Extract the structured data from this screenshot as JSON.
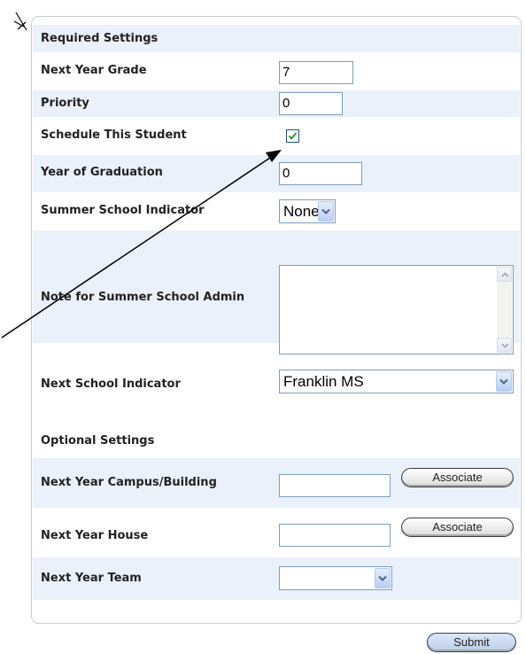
{
  "sections": {
    "required": "Required Settings",
    "optional": "Optional Settings"
  },
  "fields": {
    "next_year_grade": {
      "label": "Next Year Grade",
      "value": "7"
    },
    "priority": {
      "label": "Priority",
      "value": "0"
    },
    "schedule_student": {
      "label": "Schedule This Student",
      "checked": true
    },
    "year_of_graduation": {
      "label": "Year of Graduation",
      "value": "0"
    },
    "summer_school_indicator": {
      "label": "Summer School Indicator",
      "selected": "None"
    },
    "note_summer_admin": {
      "label": "Note for Summer School Admin",
      "value": ""
    },
    "next_school_indicator": {
      "label": "Next School Indicator",
      "selected": "Franklin MS"
    },
    "next_year_campus": {
      "label": "Next Year Campus/Building",
      "value": "",
      "button": "Associate"
    },
    "next_year_house": {
      "label": "Next Year House",
      "value": "",
      "button": "Associate"
    },
    "next_year_team": {
      "label": "Next Year Team",
      "selected": ""
    }
  },
  "submit_label": "Submit",
  "colors": {
    "row_alt": "#eaf1fb",
    "border": "#c9ccd2",
    "input_border": "#7f9db9",
    "check": "#2a9a2a"
  },
  "icons": [
    "checkmark-icon",
    "chevron-down-icon",
    "chevron-up-icon",
    "annotation-arrow-icon",
    "annotation-marker-icon"
  ]
}
